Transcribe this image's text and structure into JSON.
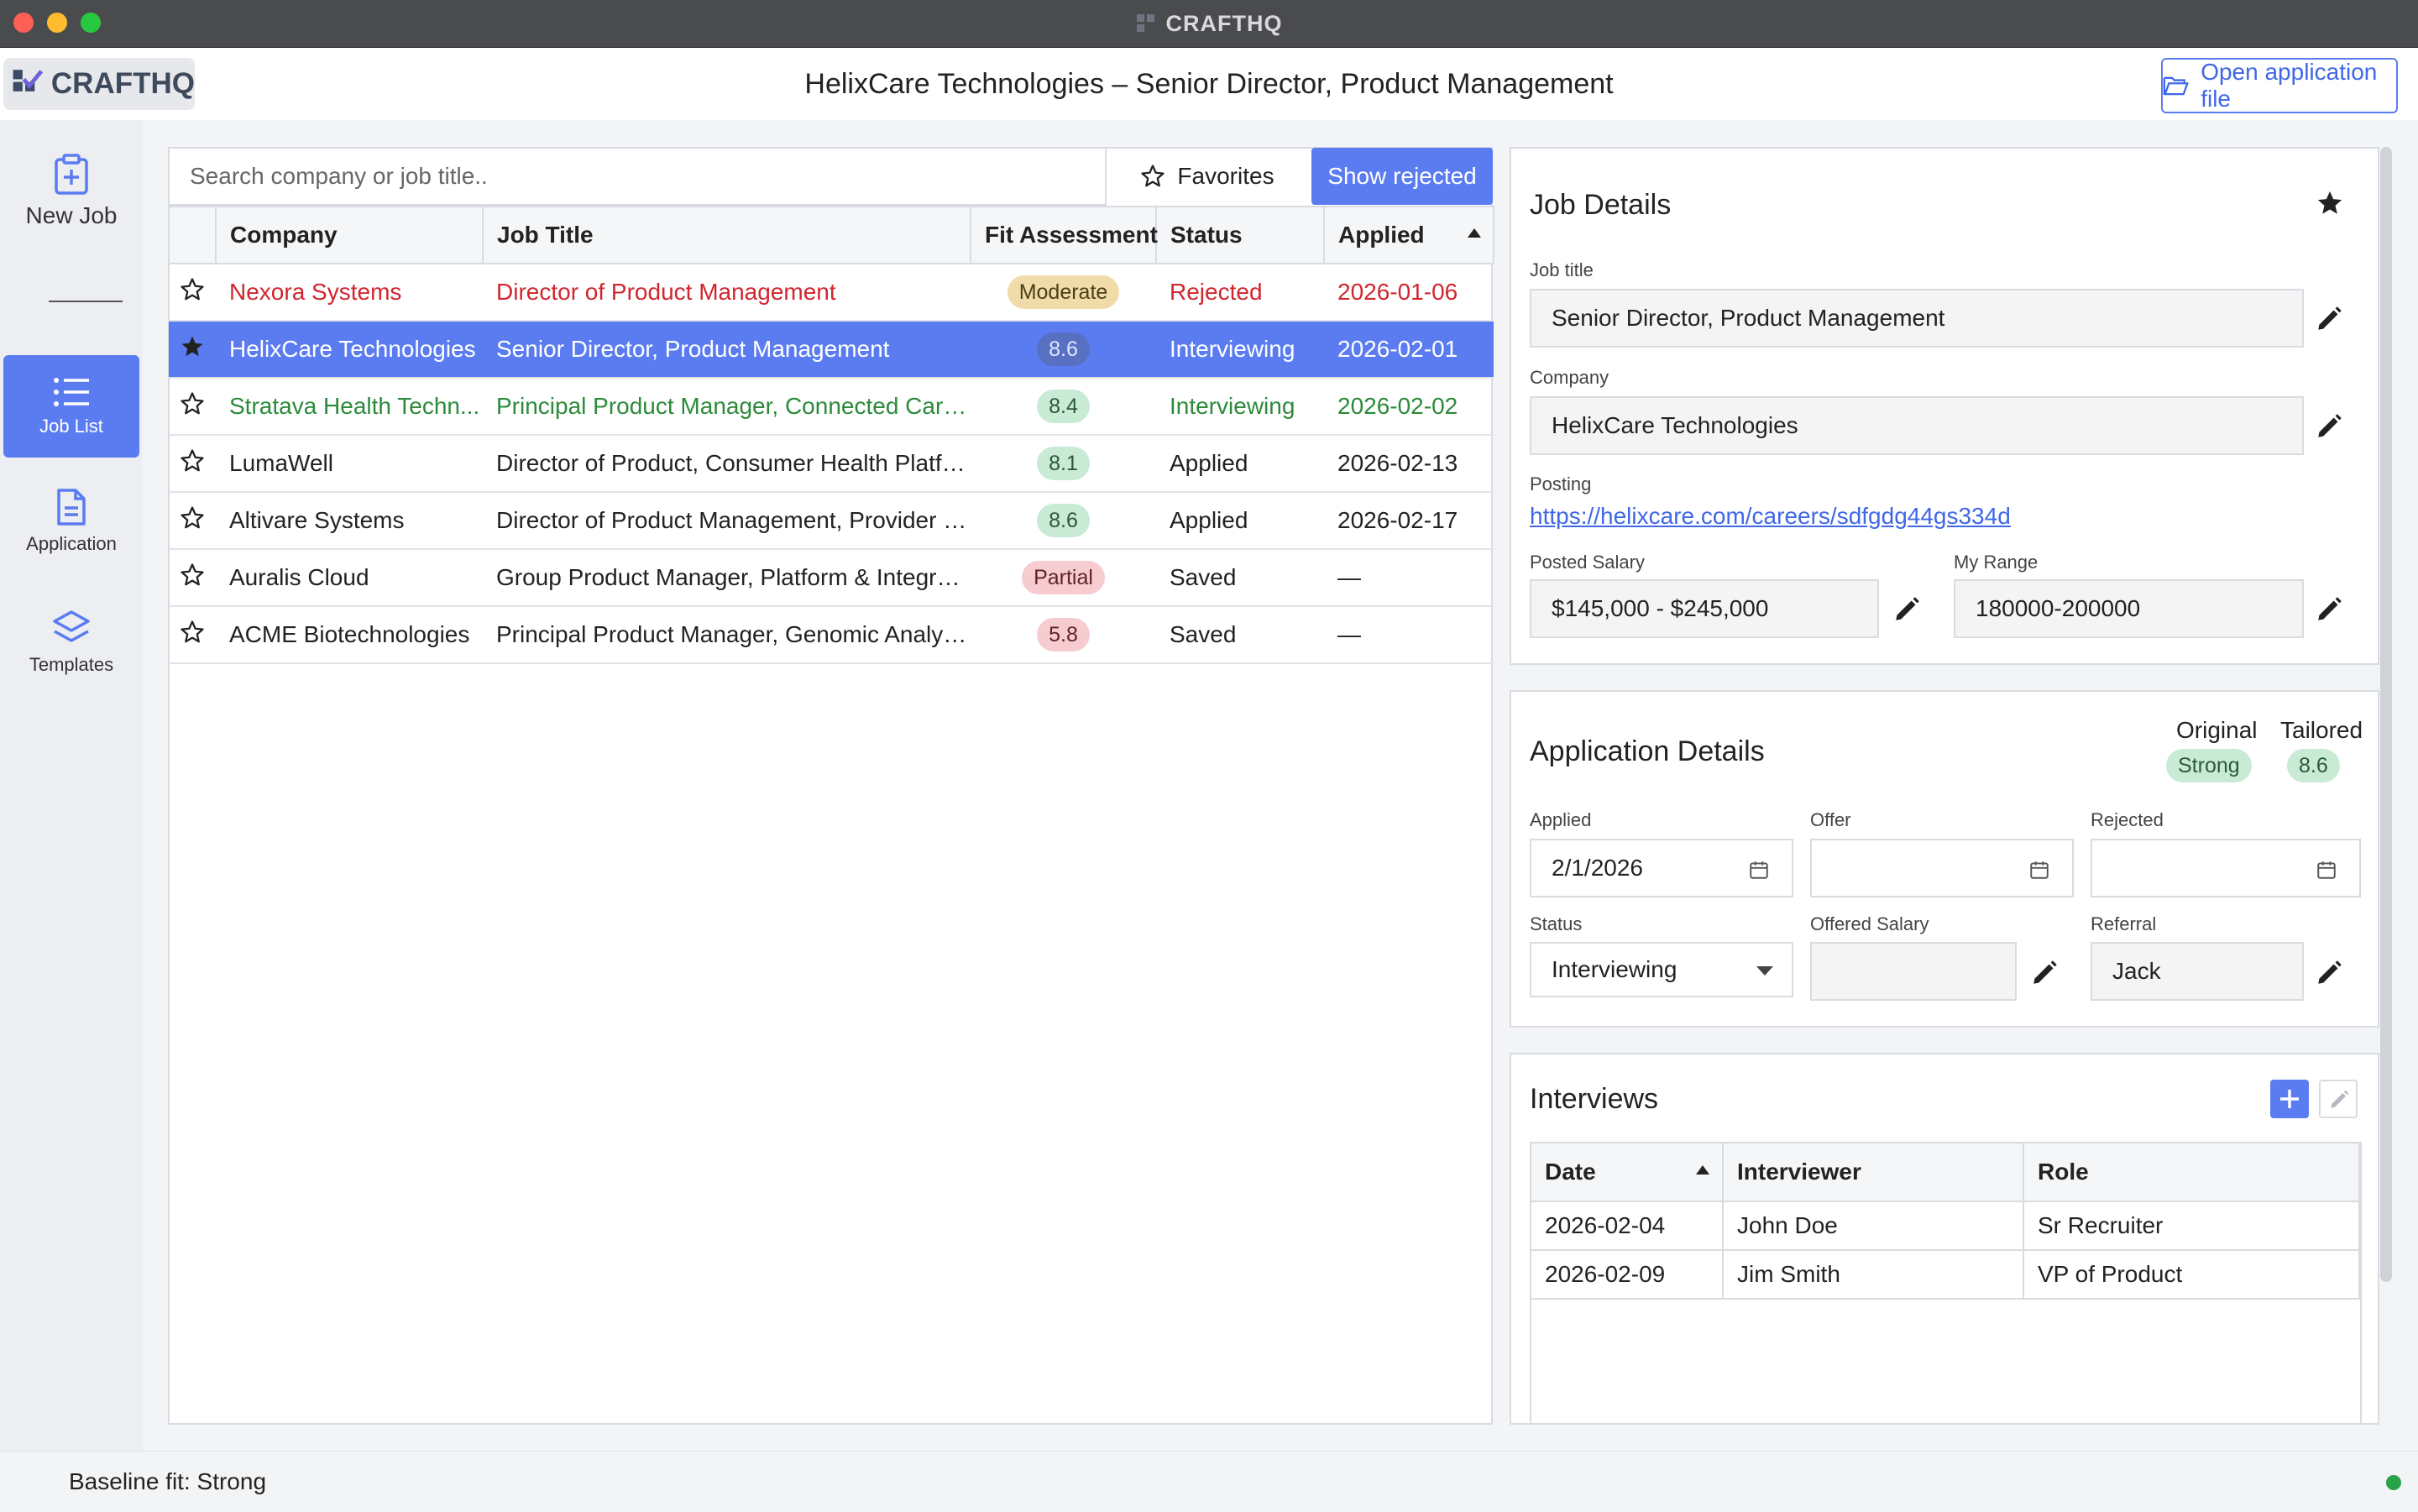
{
  "window": {
    "title": "CRAFTHQ"
  },
  "header": {
    "logo_text": "CRAFTHQ",
    "page_title": "HelixCare Technologies – Senior Director, Product Management",
    "open_file_label": "Open application file"
  },
  "sidebar": {
    "items": [
      {
        "label": "New Job",
        "icon": "clipboard-plus-icon"
      },
      {
        "label": "Job List",
        "icon": "list-icon",
        "active": true
      },
      {
        "label": "Application",
        "icon": "document-icon"
      },
      {
        "label": "Templates",
        "icon": "layers-icon"
      }
    ]
  },
  "joblist": {
    "search_placeholder": "Search company or job title..",
    "favorites_label": "Favorites",
    "show_rejected_label": "Show rejected",
    "columns": [
      "Company",
      "Job Title",
      "Fit Assessment",
      "Status",
      "Applied"
    ],
    "rows": [
      {
        "starred": false,
        "company": "Nexora Systems",
        "title": "Director of Product Management",
        "fit": "Moderate",
        "fit_style": "yellow",
        "status": "Rejected",
        "applied": "2026-01-06",
        "row_style": "rejected"
      },
      {
        "starred": true,
        "company": "HelixCare Technologies",
        "title": "Senior Director, Product Management",
        "fit": "8.6",
        "fit_style": "green",
        "status": "Interviewing",
        "applied": "2026-02-01",
        "row_style": "selected"
      },
      {
        "starred": false,
        "company": "Stratava Health Techn...",
        "title": "Principal Product Manager, Connected Care ...",
        "fit": "8.4",
        "fit_style": "green",
        "status": "Interviewing",
        "applied": "2026-02-02",
        "row_style": "interview"
      },
      {
        "starred": false,
        "company": "LumaWell",
        "title": "Director of Product, Consumer Health Platform",
        "fit": "8.1",
        "fit_style": "green",
        "status": "Applied",
        "applied": "2026-02-13",
        "row_style": ""
      },
      {
        "starred": false,
        "company": "Altivare Systems",
        "title": "Director of Product Management, Provider So...",
        "fit": "8.6",
        "fit_style": "green",
        "status": "Applied",
        "applied": "2026-02-17",
        "row_style": ""
      },
      {
        "starred": false,
        "company": "Auralis Cloud",
        "title": "Group Product Manager, Platform & Integrati...",
        "fit": "Partial",
        "fit_style": "red",
        "status": "Saved",
        "applied": "—",
        "row_style": ""
      },
      {
        "starred": false,
        "company": "ACME Biotechnologies",
        "title": "Principal Product Manager, Genomic Analysis...",
        "fit": "5.8",
        "fit_style": "red",
        "status": "Saved",
        "applied": "—",
        "row_style": ""
      }
    ]
  },
  "job_details": {
    "heading": "Job Details",
    "starred": true,
    "job_title_label": "Job title",
    "job_title": "Senior Director, Product Management",
    "company_label": "Company",
    "company": "HelixCare Technologies",
    "posting_label": "Posting",
    "posting_url": "https://helixcare.com/careers/sdfgdg44gs334d",
    "posted_salary_label": "Posted Salary",
    "posted_salary": "$145,000 - $245,000",
    "my_range_label": "My Range",
    "my_range": "180000-200000"
  },
  "application_details": {
    "heading": "Application Details",
    "original_label": "Original",
    "original_value": "Strong",
    "tailored_label": "Tailored",
    "tailored_value": "8.6",
    "applied_label": "Applied",
    "applied_value": "2/1/2026",
    "offer_label": "Offer",
    "offer_value": "",
    "rejected_label": "Rejected",
    "rejected_value": "",
    "status_label": "Status",
    "status_value": "Interviewing",
    "offered_salary_label": "Offered Salary",
    "offered_salary_value": "",
    "referral_label": "Referral",
    "referral_value": "Jack"
  },
  "interviews": {
    "heading": "Interviews",
    "columns": [
      "Date",
      "Interviewer",
      "Role"
    ],
    "rows": [
      {
        "date": "2026-02-04",
        "interviewer": "John Doe",
        "role": "Sr Recruiter"
      },
      {
        "date": "2026-02-09",
        "interviewer": "Jim Smith",
        "role": "VP of Product"
      }
    ]
  },
  "statusbar": {
    "text": "Baseline fit: Strong"
  },
  "colors": {
    "accent": "#5b7cf0",
    "rejected": "#d0262e",
    "interviewing": "#2c8a3a",
    "status_ok": "#2aa24a"
  }
}
